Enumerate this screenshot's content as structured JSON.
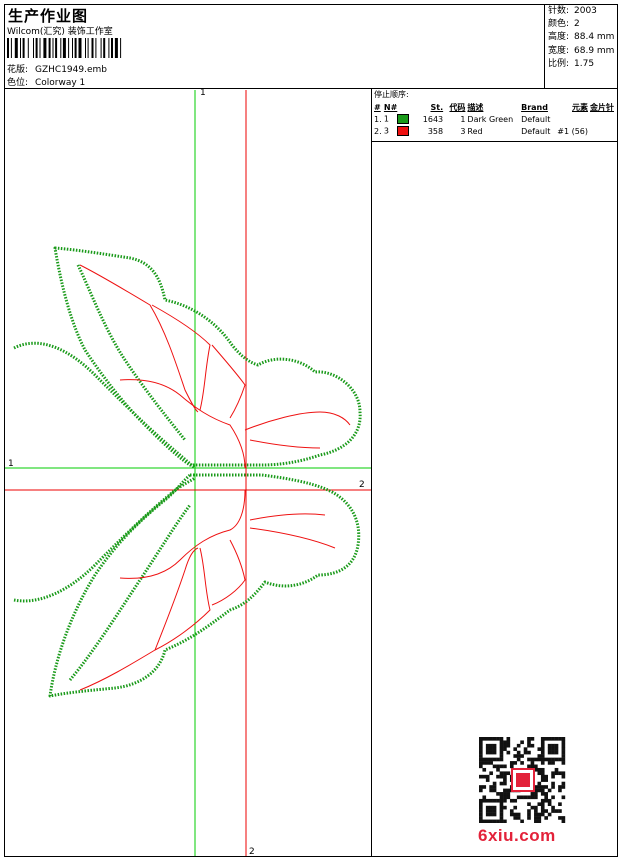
{
  "header": {
    "title": "生产作业图",
    "company": "Wilcom(汇究) 装饰工作室",
    "design_label": "花版:",
    "design_value": "GZHC1949.emb",
    "colorway_label": "色位:",
    "colorway_value": "Colorway 1"
  },
  "stats": [
    {
      "label": "针数:",
      "value": "2003"
    },
    {
      "label": "颜色:",
      "value": "2"
    },
    {
      "label": "高度:",
      "value": "88.4 mm"
    },
    {
      "label": "宽度:",
      "value": "68.9 mm"
    },
    {
      "label": "比例:",
      "value": "1.75"
    }
  ],
  "stop_sequence": {
    "title": "停止顺序:",
    "columns": [
      "#",
      "N#",
      "St.",
      "代码",
      "描述",
      "Brand",
      "元素",
      "金片针"
    ],
    "rows": [
      {
        "index": "1.",
        "needle": "1",
        "color": "#1a9a1a",
        "stitches": "1643",
        "code": "1",
        "desc": "Dark Green",
        "brand": "Default",
        "element": "",
        "sequin": ""
      },
      {
        "index": "2.",
        "needle": "3",
        "color": "#ee1111",
        "stitches": "358",
        "code": "3",
        "desc": "Red",
        "brand": "Default",
        "element": "#1 (56)",
        "sequin": ""
      }
    ]
  },
  "axes": {
    "v1": "1",
    "h1": "1",
    "h2": "2",
    "v2": "2"
  },
  "watermark": {
    "brand": "6xiu.com"
  },
  "colors": {
    "green": "#1a9a1a",
    "red": "#ee1111",
    "axis_green": "#00cc00",
    "axis_red": "#ee0000"
  }
}
